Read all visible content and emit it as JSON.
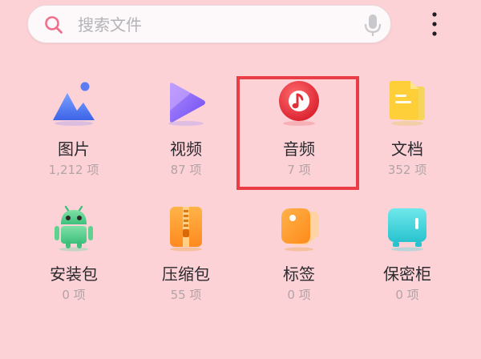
{
  "search": {
    "placeholder": "搜索文件"
  },
  "icons": {
    "search": "search-icon",
    "mic": "microphone-icon",
    "more": "more-vertical-icon"
  },
  "colors": {
    "background": "#fcd2d7",
    "highlight": "#ea3d45",
    "search_ring": "#f06f8c"
  },
  "categories": [
    {
      "label": "图片",
      "count": "1,212 项",
      "icon": "image-icon"
    },
    {
      "label": "视频",
      "count": "87 项",
      "icon": "video-icon"
    },
    {
      "label": "音频",
      "count": "7 项",
      "icon": "music-icon"
    },
    {
      "label": "文档",
      "count": "352 项",
      "icon": "document-icon"
    },
    {
      "label": "安装包",
      "count": "0 项",
      "icon": "android-icon"
    },
    {
      "label": "压缩包",
      "count": "55 项",
      "icon": "archive-icon"
    },
    {
      "label": "标签",
      "count": "0 项",
      "icon": "tag-icon"
    },
    {
      "label": "保密柜",
      "count": "0 项",
      "icon": "safe-icon"
    }
  ],
  "highlighted_category": "音频"
}
